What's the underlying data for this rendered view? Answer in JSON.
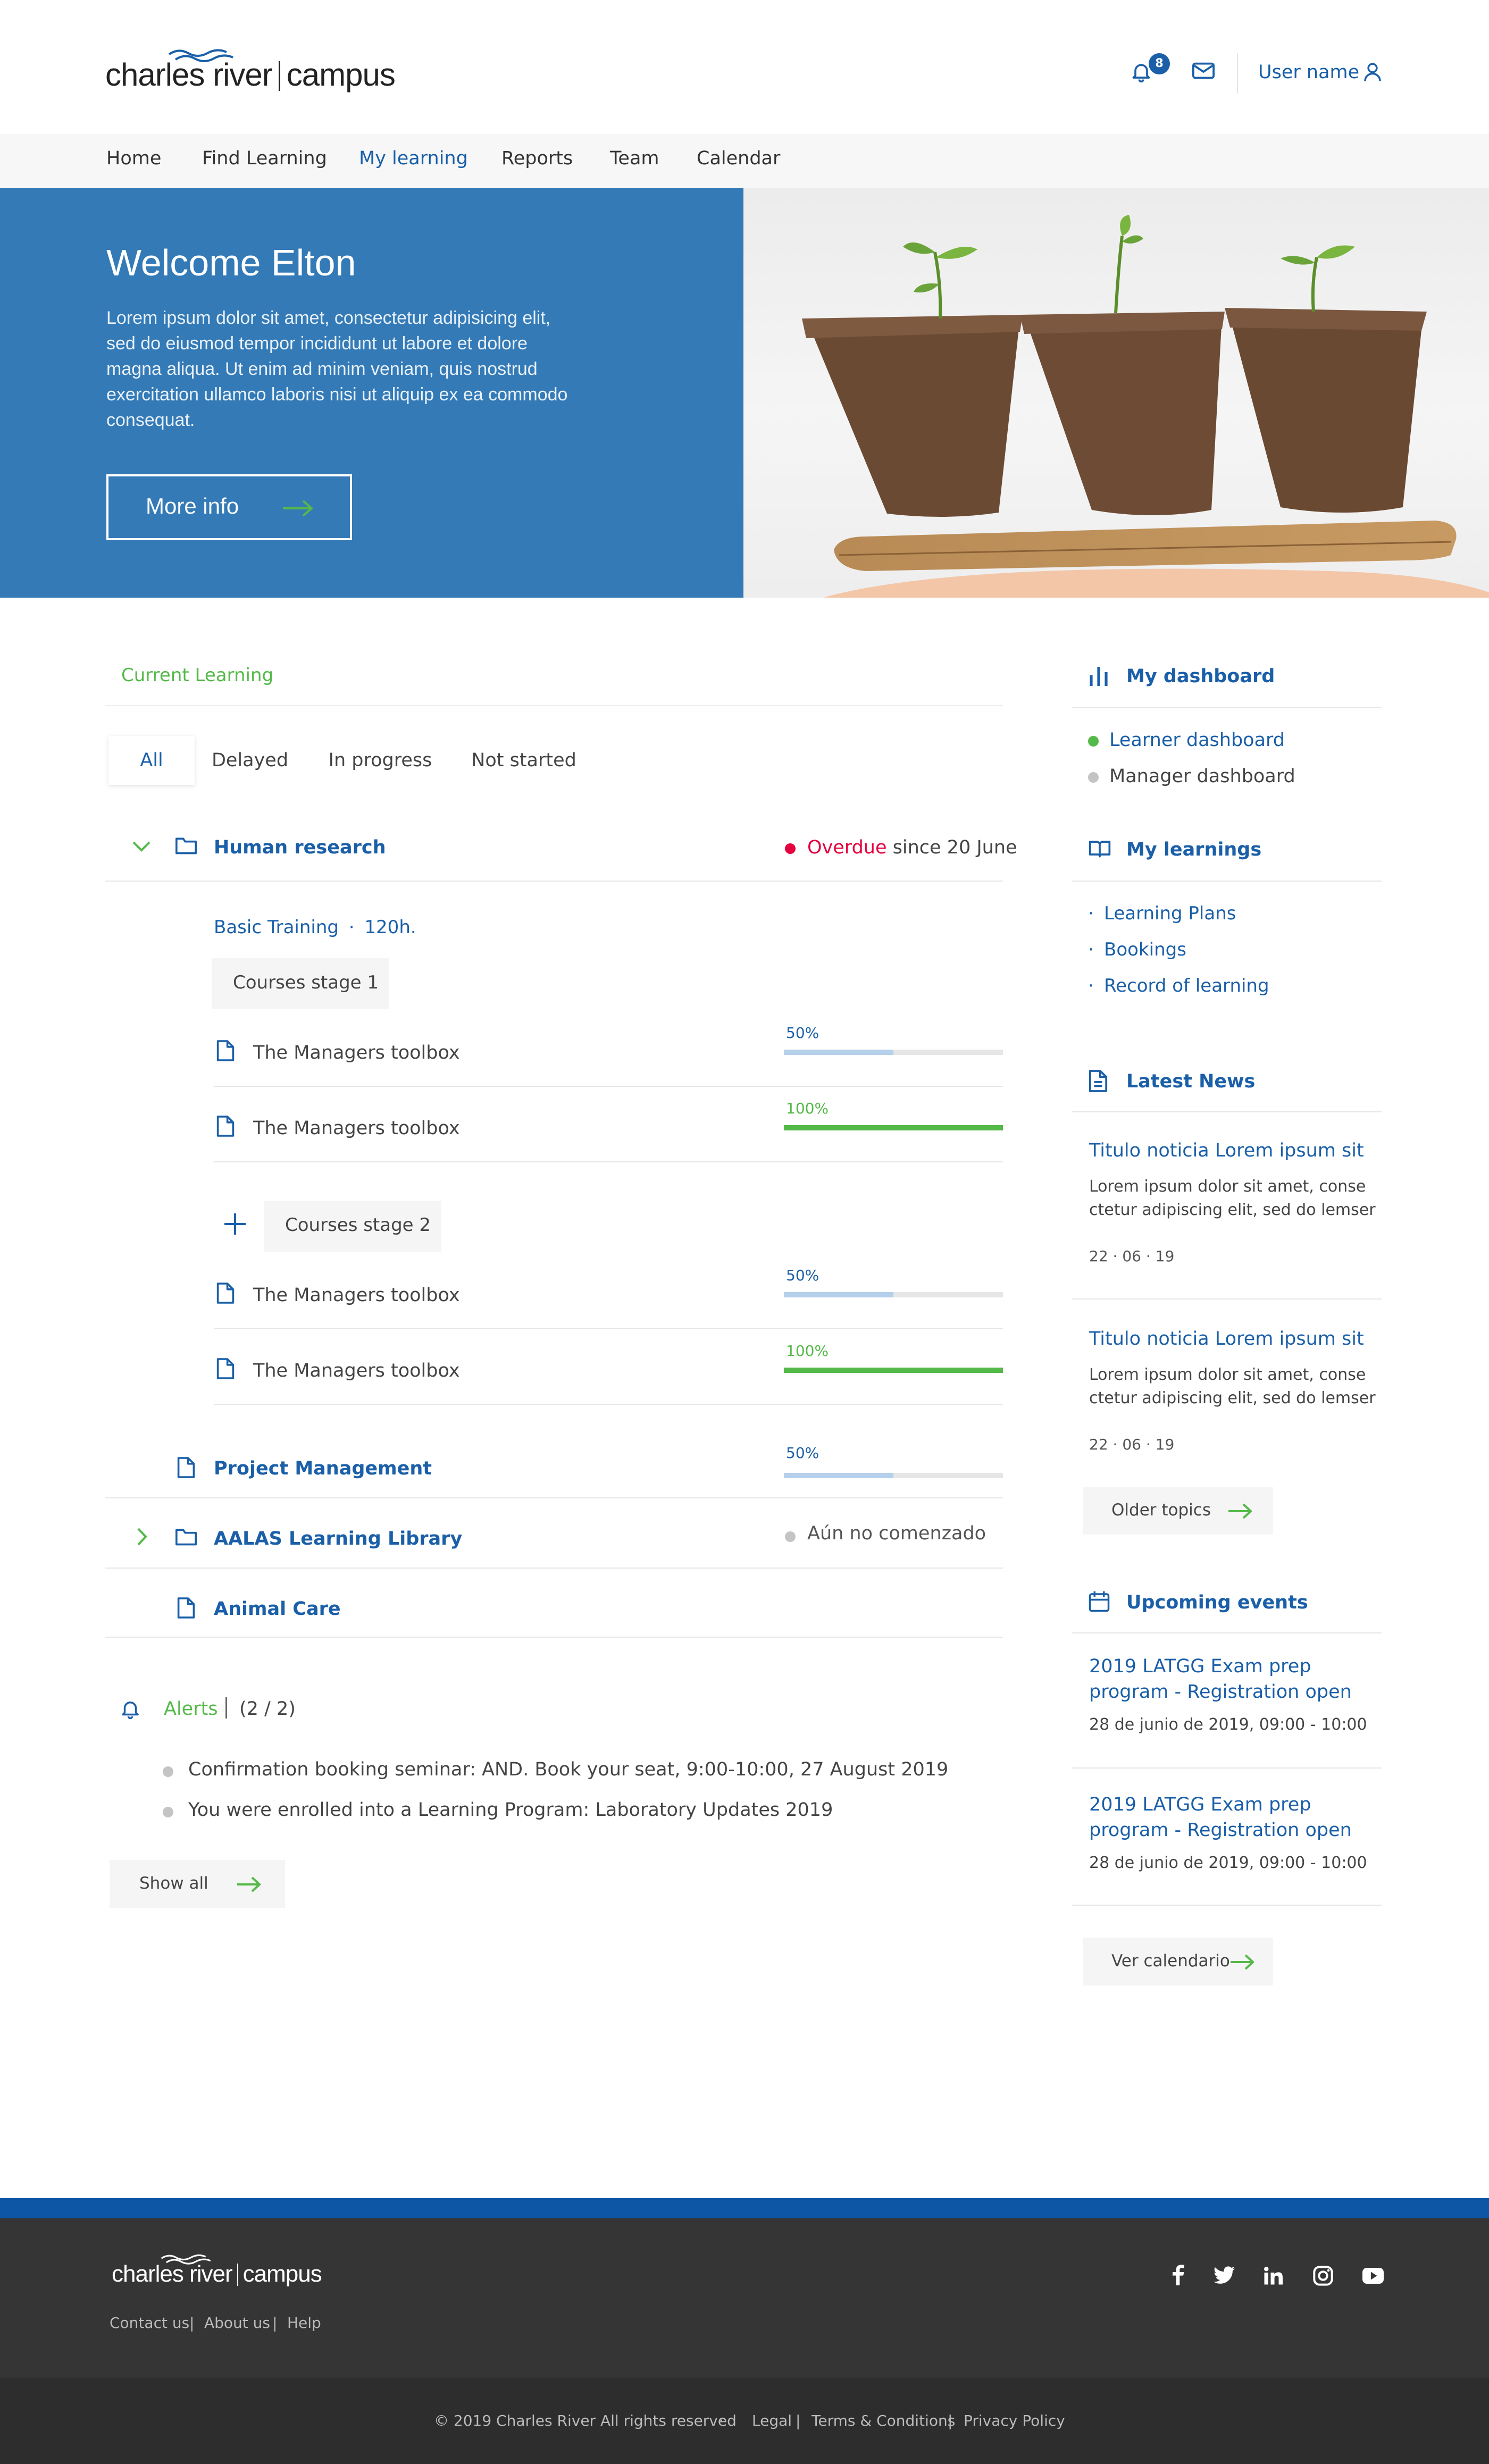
{
  "header": {
    "logo_left": "charles river",
    "logo_right": "campus",
    "notification_count": "8",
    "user_name": "User name"
  },
  "nav": [
    "Home",
    "Find Learning",
    "My learning",
    "Reports",
    "Team",
    "Calendar"
  ],
  "hero": {
    "title": "Welcome Elton",
    "body": "Lorem ipsum dolor sit amet, consectetur adipisicing elit, sed do eiusmod tempor incididunt ut labore et dolore magna aliqua. Ut enim ad minim veniam, quis nostrud exercitation ullamco laboris nisi ut aliquip ex ea commodo consequat.",
    "button": "More info"
  },
  "current_learning": {
    "heading": "Current Learning",
    "tabs": [
      "All",
      "Delayed",
      "In progress",
      "Not started"
    ],
    "group1": {
      "name": "Human research",
      "status_overdue": "Overdue",
      "status_since": " since 20 June",
      "program": "Basic Training",
      "separator": "·",
      "hours": "120h.",
      "stage1": "Courses stage 1",
      "stage2": "Courses stage 2",
      "items": [
        {
          "name": "The Managers toolbox",
          "progress_label": "50%",
          "progress": 0.5
        },
        {
          "name": "The Managers toolbox",
          "progress_label": "100%",
          "progress": 1.0
        },
        {
          "name": "The Managers toolbox",
          "progress_label": "50%",
          "progress": 0.5
        },
        {
          "name": "The Managers toolbox",
          "progress_label": "100%",
          "progress": 1.0
        }
      ]
    },
    "project": {
      "name": "Project Management",
      "progress_label": "50%",
      "progress": 0.5
    },
    "aalas": {
      "name": "AALAS Learning Library",
      "status": "Aún no comenzado"
    },
    "animal": {
      "name": "Animal Care"
    }
  },
  "alerts": {
    "title": "Alerts",
    "count": "(2 / 2)",
    "items": [
      "Confirmation booking seminar: AND. Book your seat, 9:00-10:00, 27 August 2019",
      "You were enrolled into a Learning Program: Laboratory Updates 2019"
    ],
    "show_all": "Show all"
  },
  "sidebar": {
    "dashboard_title": "My dashboard",
    "dashboard_links": [
      "Learner dashboard",
      "Manager dashboard"
    ],
    "learnings_title": "My learnings",
    "learnings_links": [
      "Learning Plans",
      "Bookings",
      "Record of learning"
    ],
    "news_title": "Latest News",
    "news": [
      {
        "title": "Titulo noticia Lorem ipsum sit",
        "line1": "Lorem ipsum dolor sit amet, conse",
        "line2": "ctetur adipiscing elit, sed do lemser",
        "date": "22 · 06 · 19"
      },
      {
        "title": "Titulo noticia Lorem ipsum sit",
        "line1": "Lorem ipsum dolor sit amet, conse",
        "line2": "ctetur adipiscing elit, sed do lemser",
        "date": "22 · 06 · 19"
      }
    ],
    "older_topics": "Older topics",
    "events_title": "Upcoming events",
    "events": [
      {
        "line1": "2019 LATGG Exam prep",
        "line2": "program - Registration open",
        "date": "28 de junio de 2019, 09:00 - 10:00"
      },
      {
        "line1": "2019 LATGG Exam prep",
        "line2": "program - Registration open",
        "date": "28 de junio de 2019, 09:00 - 10:00"
      }
    ],
    "calendar_button": "Ver calendario"
  },
  "footer": {
    "logo_left": "charles river",
    "logo_right": "campus",
    "links": [
      "Contact us",
      "About us",
      "Help"
    ],
    "copyright": "© 2019 Charles River All rights reserved",
    "legal_links": [
      "Legal",
      "Terms & Conditions",
      "Privacy Policy"
    ]
  },
  "colors": {
    "brand_blue": "#1a5fa8",
    "hero_blue": "#337ab7",
    "green": "#54b948",
    "overdue_red": "#e5003e"
  }
}
